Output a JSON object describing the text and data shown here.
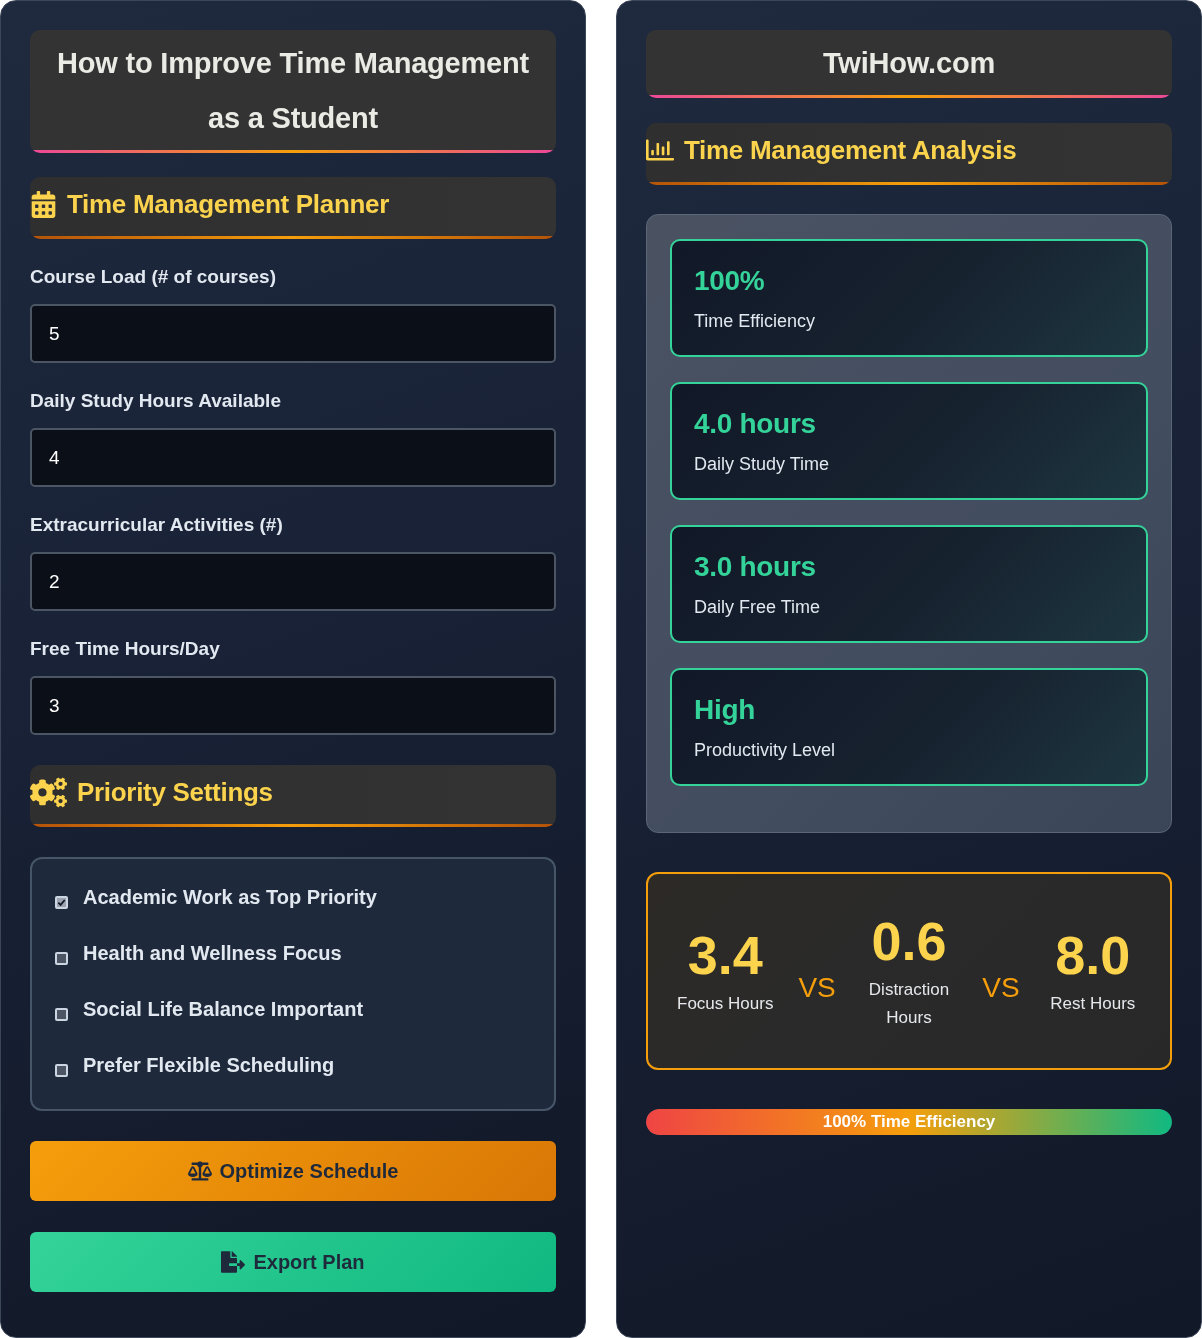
{
  "planner": {
    "title": "How to Improve Time Management as a Student",
    "section_title": "Time Management Planner",
    "fields": [
      {
        "label": "Course Load (# of courses)",
        "value": "5"
      },
      {
        "label": "Daily Study Hours Available",
        "value": "4"
      },
      {
        "label": "Extracurricular Activities (#)",
        "value": "2"
      },
      {
        "label": "Free Time Hours/Day",
        "value": "3"
      }
    ],
    "priority_title": "Priority Settings",
    "priorities": [
      {
        "label": "Academic Work as Top Priority",
        "checked": true
      },
      {
        "label": "Health and Wellness Focus",
        "checked": false
      },
      {
        "label": "Social Life Balance Important",
        "checked": false
      },
      {
        "label": "Prefer Flexible Scheduling",
        "checked": false
      }
    ],
    "buttons": [
      {
        "label": "Optimize Schedule",
        "kind": "optimize"
      },
      {
        "label": "Export Plan",
        "kind": "export"
      }
    ]
  },
  "analysis": {
    "site": "TwiHow.com",
    "section_title": "Time Management Analysis",
    "metrics": [
      {
        "value": "100%",
        "label": "Time Efficiency"
      },
      {
        "value": "4.0 hours",
        "label": "Daily Study Time"
      },
      {
        "value": "3.0 hours",
        "label": "Daily Free Time"
      },
      {
        "value": "High",
        "label": "Productivity Level"
      }
    ],
    "comparison": [
      {
        "kind": "stat",
        "value": "3.4",
        "label": "Focus Hours"
      },
      {
        "kind": "separator",
        "label": "VS"
      },
      {
        "kind": "stat",
        "value": "0.6",
        "label": "Distraction Hours"
      },
      {
        "kind": "separator",
        "label": "VS"
      },
      {
        "kind": "stat",
        "value": "8.0",
        "label": "Rest Hours"
      }
    ],
    "efficiency_bar": {
      "label": "100% Time Efficiency",
      "level": 1
    }
  }
}
